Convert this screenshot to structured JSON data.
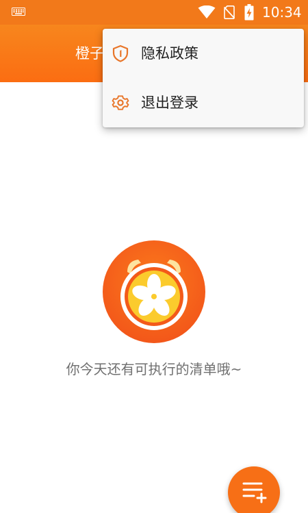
{
  "status_bar": {
    "time": "10:34",
    "icons": [
      "keyboard-icon",
      "wifi-icon",
      "no-sim-icon",
      "battery-charging-icon"
    ]
  },
  "app_bar": {
    "title": "橙子"
  },
  "menu": {
    "items": [
      {
        "label": "隐私政策",
        "icon": "shield-icon"
      },
      {
        "label": "退出登录",
        "icon": "gear-icon"
      }
    ]
  },
  "main": {
    "empty_message": "你今天还有可执行的清单哦~",
    "logo_icon": "orange-alarm-clock-logo"
  },
  "fab": {
    "icon": "add-list-icon"
  },
  "colors": {
    "brand_orange": "#f7861d",
    "fab_orange": "#f76f16",
    "menu_bg": "#f8f8f8",
    "text_gray": "#6f6f6f"
  }
}
